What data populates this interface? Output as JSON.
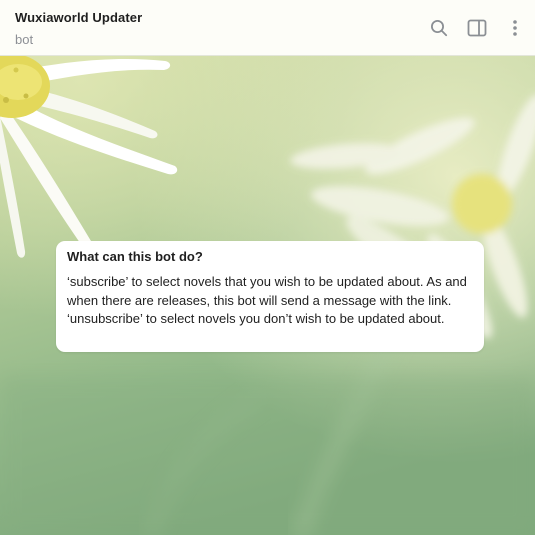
{
  "chat": {
    "title": "Wuxiaworld Updater",
    "subtitle": "bot"
  },
  "header_actions": {
    "search_icon": "search-icon",
    "sidebar_icon": "sidebar-toggle-icon",
    "more_icon": "more-vertical-icon"
  },
  "bot_info": {
    "heading": "What can this bot do?",
    "lines": [
      "‘subscribe’ to select novels that you wish to be updated about. As and when there are releases, this bot will send a message with the link.",
      "‘unsubscribe’ to select novels you don’t wish to be updated about."
    ]
  },
  "colors": {
    "header_bg": "#fdfdf8",
    "card_bg": "#ffffff",
    "subtitle": "#8c8f95",
    "icon": "#8b8f94"
  }
}
